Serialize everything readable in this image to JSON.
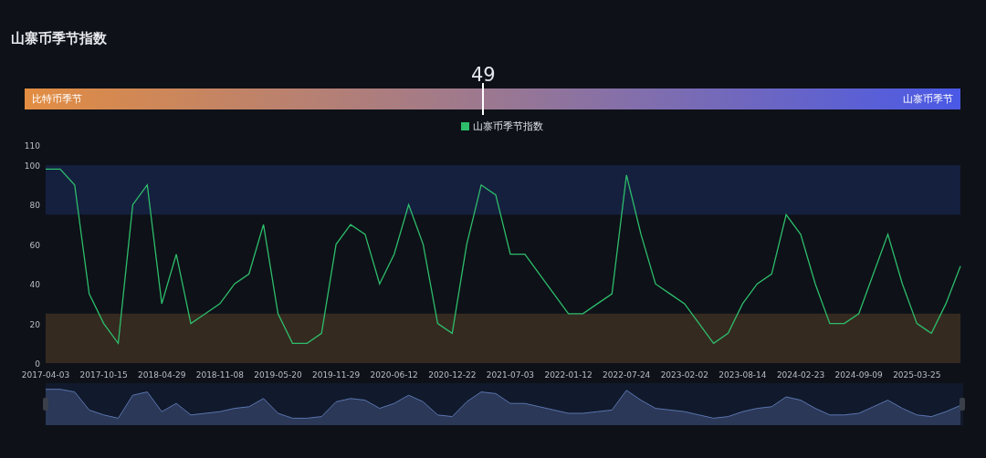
{
  "title": "山寨币季节指数",
  "zoom_slider": {
    "level": 1
  },
  "gauge": {
    "value": "49",
    "level": 0.49,
    "left_label": "比特币季节",
    "right_label": "山寨币季节"
  },
  "chart_data": {
    "type": "line",
    "ylim": [
      0,
      110
    ],
    "yticks": [
      0,
      20,
      40,
      60,
      80,
      100,
      110
    ],
    "categories": [
      "2017-04-03",
      null,
      null,
      null,
      "2017-10-15",
      null,
      null,
      null,
      "2018-04-29",
      null,
      null,
      null,
      "2018-11-08",
      null,
      null,
      null,
      "2019-05-20",
      null,
      null,
      null,
      "2019-11-29",
      null,
      null,
      null,
      "2020-06-12",
      null,
      null,
      null,
      "2020-12-22",
      null,
      null,
      null,
      "2021-07-03",
      null,
      null,
      null,
      "2022-01-12",
      null,
      null,
      null,
      "2022-07-24",
      null,
      null,
      null,
      "2023-02-02",
      null,
      null,
      null,
      "2023-08-14",
      null,
      null,
      null,
      "2024-02-23",
      null,
      null,
      null,
      "2024-09-09",
      null,
      null,
      null,
      "2025-03-25",
      null,
      null,
      null
    ],
    "bands": [
      {
        "axis": "y",
        "from": 75,
        "to": 100,
        "color": "#15203f"
      },
      {
        "axis": "y",
        "from": 0,
        "to": 25,
        "color": "#352a20"
      }
    ],
    "series": [
      {
        "name": "山寨币季节指数",
        "color": "#2ebd6b",
        "values": [
          98,
          98,
          90,
          35,
          20,
          10,
          80,
          90,
          30,
          55,
          20,
          25,
          30,
          40,
          45,
          70,
          25,
          10,
          10,
          15,
          60,
          70,
          65,
          40,
          55,
          80,
          60,
          20,
          15,
          60,
          90,
          85,
          55,
          55,
          45,
          35,
          25,
          25,
          30,
          35,
          95,
          65,
          40,
          35,
          30,
          20,
          10,
          15,
          30,
          40,
          45,
          75,
          65,
          40,
          20,
          20,
          25,
          45,
          65,
          40,
          20,
          15,
          30,
          49
        ]
      }
    ]
  }
}
